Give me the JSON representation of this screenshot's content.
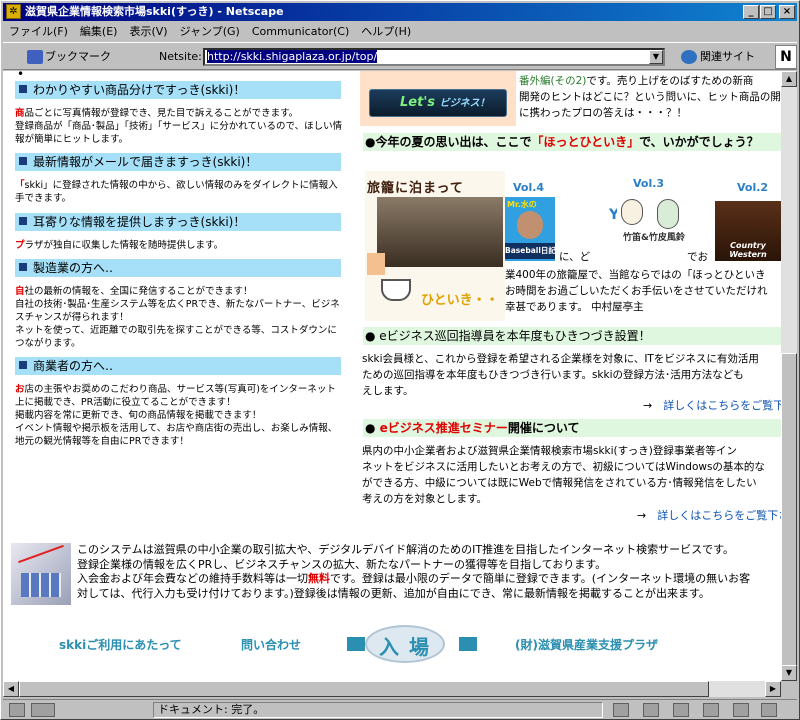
{
  "window": {
    "title": "滋賀県企業情報検索市場skki(すっき) - Netscape",
    "controls": [
      "_",
      "□",
      "×"
    ]
  },
  "menu": [
    "ファイル(F)",
    "編集(E)",
    "表示(V)",
    "ジャンプ(G)",
    "Communicator(C)",
    "ヘルプ(H)"
  ],
  "toolbar": {
    "bookmark": "ブックマーク",
    "netsite_label": "Netsite:",
    "url": "http://skki.shigaplaza.or.jp/top/",
    "related": "関連サイト",
    "logo": "N"
  },
  "left": {
    "top_bullet": "•",
    "sections": [
      {
        "heading": "わかりやすい商品分けですっき(skki)！",
        "lead": "商",
        "body": "品ごとに写真情報が登録でき、見た目で訴えることができます。\n登録商品が「商品･製品」「技術」「サービス」に分かれているので、ほしい情報が簡単にヒットします。"
      },
      {
        "heading": "最新情報がメールで届きますっき(skki)！",
        "lead": "「",
        "body": "skki」に登録された情報の中から、欲しい情報のみをダイレクトに情報入手できます。"
      },
      {
        "heading": "耳寄りな情報を提供しますっき(skki)！",
        "lead": "プ",
        "body": "ラザが独自に収集した情報を随時提供します。"
      },
      {
        "heading": "製造業の方へ‥",
        "lead": "自",
        "body": "社の最新の情報を、全国に発信することができます！\n自社の技術･製品･生産システム等を広くPRでき、新たなパートナー、ビジネスチャンスが得られます！\nネットを使って、近距離での取引先を探すことができる等、コストダウンにつながります。"
      },
      {
        "heading": "商業者の方へ‥",
        "lead": "お",
        "body": "店の主張やお奨めのこだわり商品、サービス等(写真可)をインターネット上に掲載でき、PR活動に役立てることができます！\n掲載内容を常に更新でき、旬の商品情報を掲載できます！\nイベント情報や掲示板を活用して、お店や商店街の売出し、お楽しみ情報、地元の観光情報等を自由にPRできます！"
      }
    ]
  },
  "right": {
    "letsbiz": {
      "line1": "Let's",
      "line2": "ビジネス！"
    },
    "intro_highlight": "番外編(その2)",
    "intro_lines": [
      "です。売り上げをのばすための新商",
      "開発のヒントはどこに？という問いに、ヒット商品の開",
      "に携わったプロの答えは・・・？！"
    ],
    "summer_head_a": "●今年の夏の思い出は、ここで",
    "summer_head_b": "「ほっとひといき」",
    "summer_head_c": "で、いかがでしょう？",
    "hotto": {
      "title": "旅籠に泊まって",
      "caption": "ひといき・・"
    },
    "vols": [
      {
        "label": "Vol.4",
        "title": "Baseball日記",
        "name": "Mr.水の"
      },
      {
        "label": "Vol.3",
        "title": "竹笛&竹皮風鈴"
      },
      {
        "label": "Vol.2",
        "title": "Country Western"
      }
    ],
    "summer_frags": [
      "に、ど",
      "でお",
      "業400年の旅籠屋で、当館ならではの「ほっとひといき",
      "お時間をお過ごしいただくお手伝いをさせていただけれ",
      "幸甚であります。    中村屋亭主"
    ],
    "ebiz_head": "● eビジネス巡回指導員を本年度もひきつづき設置！",
    "ebiz_body": [
      "skki会員様と、これから登録を希望される企業様を対象に、ITをビジネスに有効活用",
      "ための巡回指導を本年度もひきつづき行います。skkiの登録方法･活用方法なども",
      "えします。"
    ],
    "more_arrow": "→",
    "more1": "詳しくはこちらをご覧下さ",
    "seminar_bullet": "●",
    "seminar_red": "eビジネス推進セミナー",
    "seminar_rest": "開催について",
    "seminar_body": [
      "県内の中小企業者および滋賀県企業情報検索市場skki(すっき)登録事業者等イン",
      "ネットをビジネスに活用したいとお考えの方で、初級についてはWindowsの基本的な",
      "ができる方、中級については既にWebで情報発信をされている方･情報発信をしたい",
      "考えの方を対象とします。"
    ],
    "more2": "詳しくはこちらをご覧下さ"
  },
  "bottom": {
    "lines": [
      "このシステムは滋賀県の中小企業の取引拡大や、デジタルデバイド解消のためのIT推進を目指したインターネット検索サービスです。",
      "登録企業様の情報を広くPRし、ビジネスチャンスの拡大、新たなパートナーの獲得等を目指しております。"
    ],
    "fee_a": "入会金および年会費などの維持手数料等は一切",
    "fee_red": "無料",
    "fee_b": "です。登録は最小限のデータで簡単に登録できます。(インターネット環境の無いお客",
    "fee_line2": "対しては、代行入力も受け付けております。)登録後は情報の更新、追加が自由にでき、常に最新情報を掲載することが出来ます。"
  },
  "footer_nav": {
    "terms": "skkiご利用にあたって",
    "contact": "問い合わせ",
    "enter": "入場",
    "plaza": "(財)滋賀県産業支援プラザ"
  },
  "status": {
    "text": "ドキュメント: 完了。"
  }
}
